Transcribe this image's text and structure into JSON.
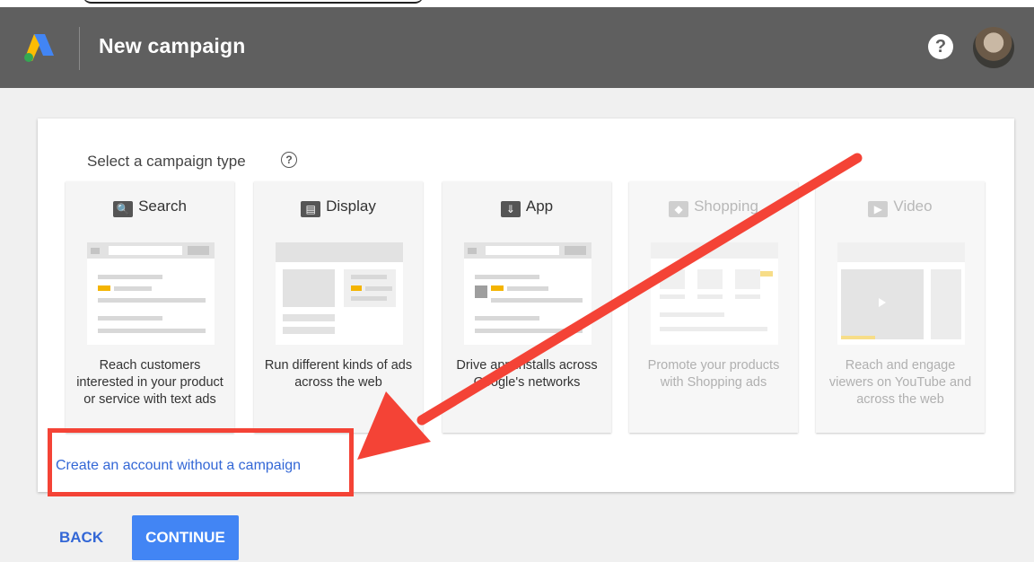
{
  "app": {
    "title": "New campaign",
    "help": "?"
  },
  "panel": {
    "prompt": "Select a campaign type",
    "prompt_help": "?",
    "cards": [
      {
        "name": "Search",
        "icon": "search-icon",
        "desc": "Reach customers interested in your product or service with text ads",
        "dim": false
      },
      {
        "name": "Display",
        "icon": "display-icon",
        "desc": "Run different kinds of ads across the web",
        "dim": false
      },
      {
        "name": "App",
        "icon": "download-icon",
        "desc": "Drive app installs across Google's networks",
        "dim": false
      },
      {
        "name": "Shopping",
        "icon": "tag-icon",
        "desc": "Promote your products with Shopping ads",
        "dim": true
      },
      {
        "name": "Video",
        "icon": "video-camera-icon",
        "desc": "Reach and engage viewers on YouTube and across the web",
        "dim": true
      }
    ],
    "link": "Create an account without a campaign"
  },
  "footer": {
    "back": "BACK",
    "continue": "CONTINUE"
  },
  "colors": {
    "appbar": "#5f5f5f",
    "accent": "#4285f4",
    "link": "#3367d6",
    "annotation": "#f44336",
    "highlight": "#f4b400"
  }
}
